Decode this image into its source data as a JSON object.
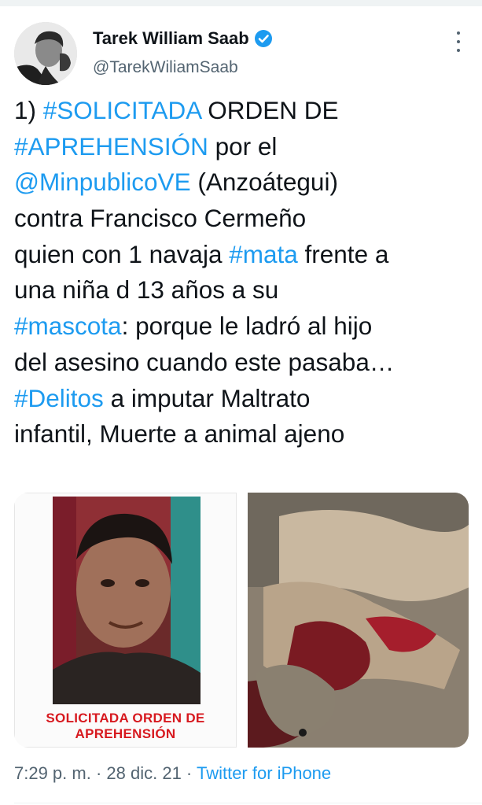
{
  "author": {
    "name": "Tarek William Saab",
    "handle": "@TarekWiliamSaab",
    "verified_icon": "verified-badge-icon",
    "avatar_icon": "avatar-portrait"
  },
  "menu": {
    "icon": "more-vertical-icon"
  },
  "tweet": {
    "lines": [
      {
        "segments": [
          {
            "text": "1) "
          },
          {
            "text": "#SOLICITADA",
            "link": true
          },
          {
            "text": " ORDEN DE"
          }
        ]
      },
      {
        "segments": [
          {
            "text": "#APREHENSIÓN",
            "link": true
          },
          {
            "text": " por el"
          }
        ]
      },
      {
        "segments": [
          {
            "text": "@MinpublicoVE",
            "link": true
          },
          {
            "text": " (Anzoátegui)"
          }
        ]
      },
      {
        "segments": [
          {
            "text": "contra Francisco Cermeño"
          }
        ]
      },
      {
        "segments": [
          {
            "text": "quien con 1 navaja "
          },
          {
            "text": "#mata",
            "link": true
          },
          {
            "text": " frente a"
          }
        ]
      },
      {
        "segments": [
          {
            "text": "una niña d 13 años a su"
          }
        ]
      },
      {
        "segments": [
          {
            "text": "#mascota",
            "link": true
          },
          {
            "text": ": porque le ladró al hijo"
          }
        ]
      },
      {
        "segments": [
          {
            "text": "del asesino cuando este pasaba…"
          }
        ]
      },
      {
        "segments": [
          {
            "text": "#Delitos",
            "link": true
          },
          {
            "text": " a imputar Maltrato"
          }
        ]
      },
      {
        "segments": [
          {
            "text": "infantil, Muerte a animal ajeno"
          }
        ]
      }
    ]
  },
  "media": {
    "left": {
      "caption_line1": "SOLICITADA ORDEN DE",
      "caption_line2": "APREHENSIÓN"
    }
  },
  "meta": {
    "time": "7:29 p. m.",
    "separator": " · ",
    "date": "28 dic. 21",
    "source": "Twitter for iPhone"
  },
  "colors": {
    "link": "#1d9bf0",
    "text": "#0f1419",
    "secondary": "#536471",
    "caption_red": "#d7191f"
  }
}
